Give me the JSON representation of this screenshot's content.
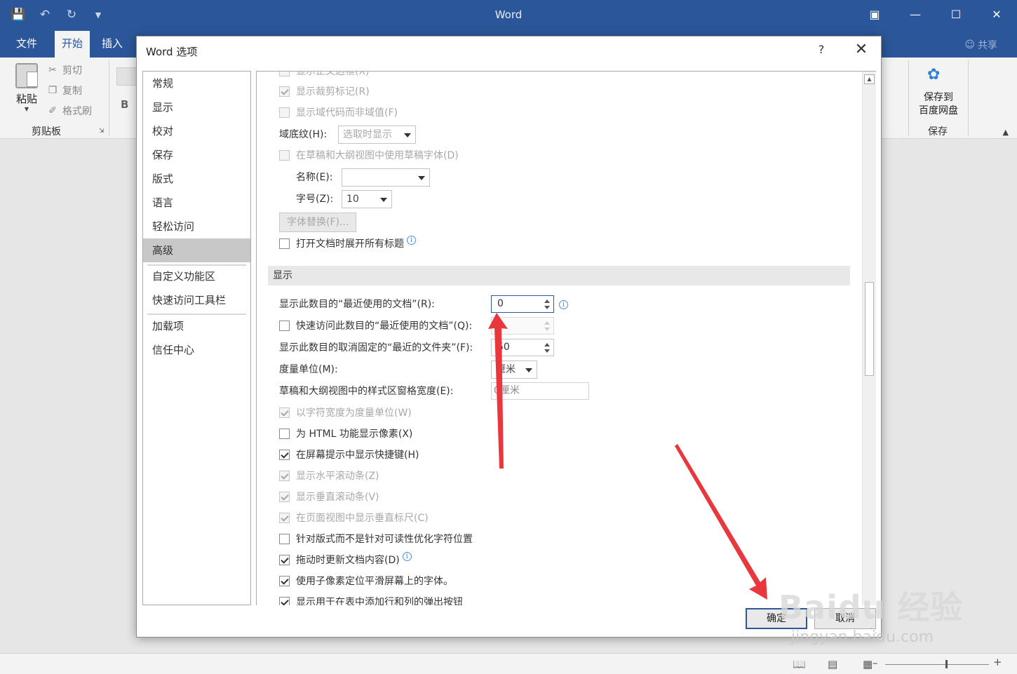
{
  "window": {
    "title": "Word",
    "share": "共享"
  },
  "tabs": [
    {
      "label": "文件"
    },
    {
      "label": "开始"
    },
    {
      "label": "插入"
    }
  ],
  "ribbon": {
    "paste": "粘贴",
    "cut": "剪切",
    "copy": "复制",
    "format_painter": "格式刷",
    "clipboard_group": "剪贴板",
    "bold": "B",
    "save_to_baidu": "保存到\n百度网盘",
    "save_group": "保存"
  },
  "dialog": {
    "title": "Word 选项",
    "help": "?",
    "close": "✕",
    "nav": [
      {
        "label": "常规"
      },
      {
        "label": "显示"
      },
      {
        "label": "校对"
      },
      {
        "label": "保存"
      },
      {
        "label": "版式"
      },
      {
        "label": "语言"
      },
      {
        "label": "轻松访问"
      },
      {
        "label": "高级"
      },
      {
        "label": "自定义功能区"
      },
      {
        "label": "快速访问工具栏"
      },
      {
        "label": "加载项"
      },
      {
        "label": "信任中心"
      }
    ],
    "nav_selected": "高级",
    "options": {
      "show_text_boundaries": "显示正文边框(X)",
      "show_crop_marks": "显示裁剪标记(R)",
      "show_field_codes": "显示域代码而非域值(F)",
      "field_shading_label": "域底纹(H):",
      "field_shading_value": "选取时显示",
      "draft_font": "在草稿和大纲视图中使用草稿字体(D)",
      "name_label": "名称(E):",
      "name_value": "",
      "size_label": "字号(Z):",
      "size_value": "10",
      "font_sub_button": "字体替换(F)...",
      "expand_headings": "打开文档时展开所有标题"
    },
    "display_section": {
      "title": "显示",
      "recent_docs_label": "显示此数目的“最近使用的文档”(R):",
      "recent_docs_value": "0",
      "quick_access_label": "快速访问此数目的“最近使用的文档”(Q):",
      "quick_access_value": "",
      "unpinned_folders_label": "显示此数目的取消固定的“最近的文件夹”(F):",
      "unpinned_folders_value": "50",
      "units_label": "度量单位(M):",
      "units_value": "厘米",
      "style_area_label": "草稿和大纲视图中的样式区窗格宽度(E):",
      "style_area_value": "0厘米",
      "char_width_units": "以字符宽度为度量单位(W)",
      "html_pixels": "为 HTML 功能显示像素(X)",
      "screen_tip_shortcuts": "在屏幕提示中显示快捷键(H)",
      "h_scrollbar": "显示水平滚动条(Z)",
      "v_scrollbar": "显示垂直滚动条(V)",
      "v_ruler": "在页面视图中显示垂直标尺(C)",
      "optimize_layout": "针对版式而不是针对可读性优化字符位置",
      "update_on_drag": "拖动时更新文档内容(D)",
      "subpixel": "使用子像素定位平滑屏幕上的字体。",
      "table_popup": "显示用于在表中添加行和列的弹出按钮"
    },
    "ok": "确定",
    "cancel": "取消"
  },
  "watermark": {
    "brand": "Baidu 经验",
    "url": "jingyan.baidu.com"
  },
  "colors": {
    "word_blue": "#2b579a",
    "arrow_red": "#e8383d"
  }
}
